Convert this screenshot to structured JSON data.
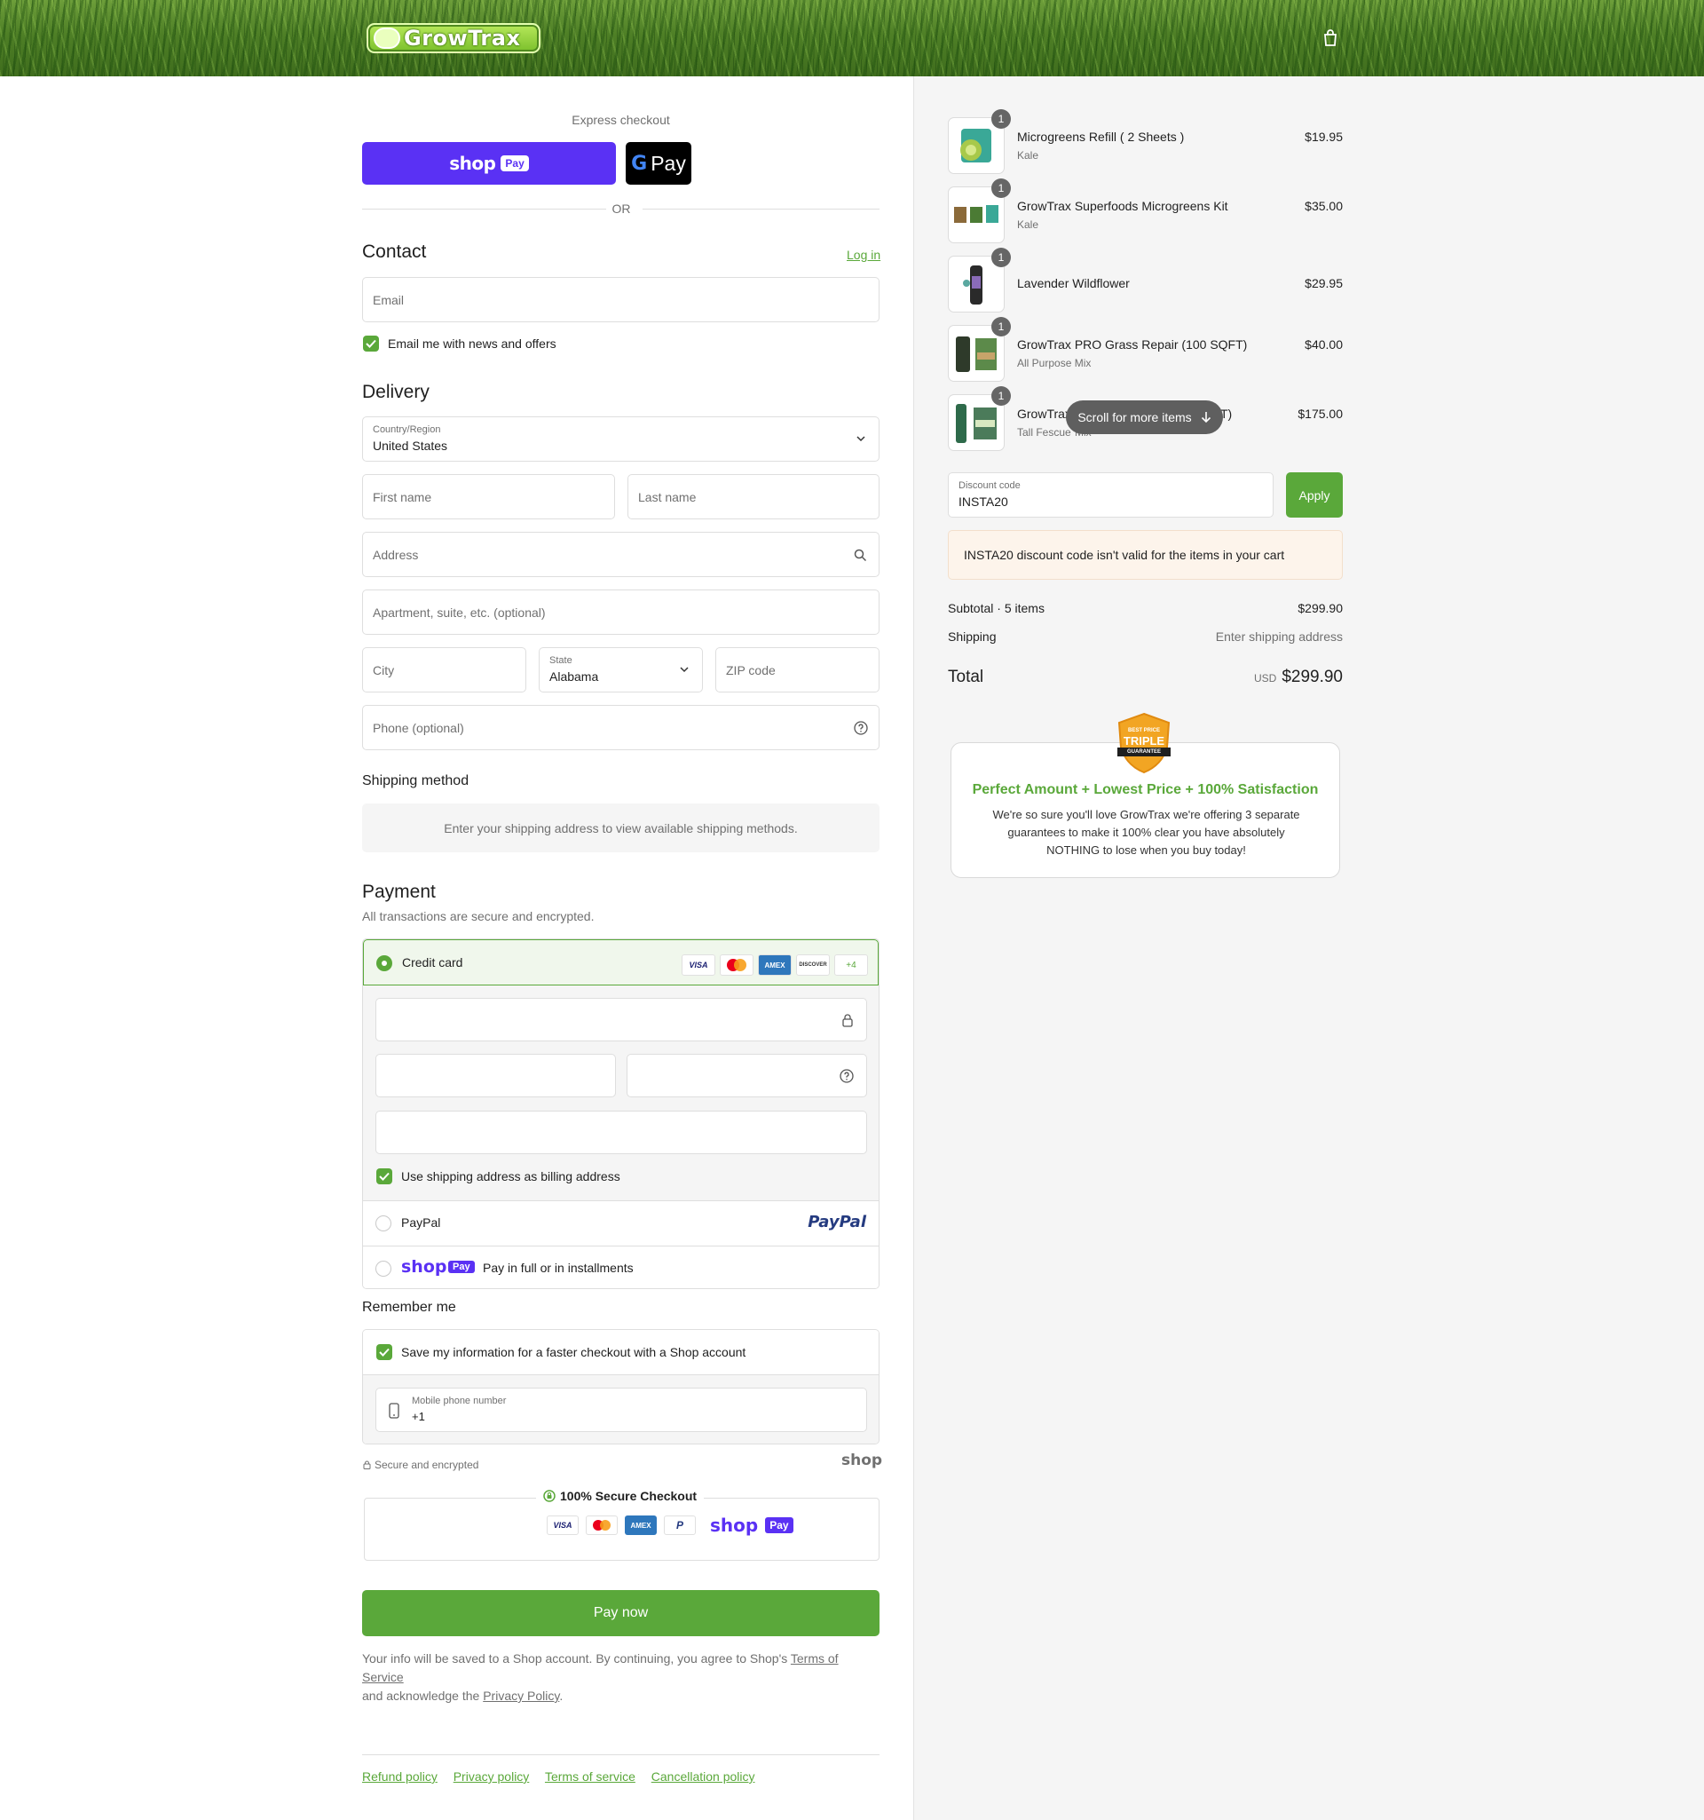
{
  "header": {
    "logo_text": "GrowTrax",
    "cart_icon": "shopping-bag-icon"
  },
  "express": {
    "title": "Express checkout",
    "shop_pay": "shop",
    "shop_pay_badge": "Pay",
    "gpay_label": "Pay",
    "or": "OR"
  },
  "contact": {
    "title": "Contact",
    "login": "Log in",
    "email_placeholder": "Email",
    "news_label": "Email me with news and offers"
  },
  "delivery": {
    "title": "Delivery",
    "country_label": "Country/Region",
    "country_value": "United States",
    "first_name": "First name",
    "last_name": "Last name",
    "address": "Address",
    "apartment": "Apartment, suite, etc. (optional)",
    "city": "City",
    "state_label": "State",
    "state_value": "Alabama",
    "zip": "ZIP code",
    "phone": "Phone (optional)"
  },
  "shipping": {
    "title": "Shipping method",
    "message": "Enter your shipping address to view available shipping methods."
  },
  "payment": {
    "title": "Payment",
    "subtitle": "All transactions are secure and encrypted.",
    "credit_card": "Credit card",
    "cards": [
      "VISA",
      "",
      "AMEX",
      "DISCOVER",
      "+4"
    ],
    "billing_same": "Use shipping address as billing address",
    "paypal": "PayPal",
    "paypal_logo": "PayPal",
    "shop_pay": "shop",
    "shop_pay_badge": "Pay",
    "shop_pay_text": "Pay in full or in installments"
  },
  "remember": {
    "title": "Remember me",
    "save_label": "Save my information for a faster checkout with a Shop account",
    "mobile_label": "Mobile phone number",
    "mobile_value": "+1",
    "secure": "Secure and encrypted",
    "shop_logo": "shop"
  },
  "secure_checkout": {
    "title": "100% Secure Checkout",
    "badges": [
      "VISA",
      "",
      "AMEX",
      "P"
    ],
    "shop": "shop",
    "shop_badge": "Pay"
  },
  "pay_now": "Pay now",
  "legal": {
    "text1": "Your info will be saved to a Shop account. By continuing, you agree to Shop's ",
    "terms": "Terms of Service",
    "text2": "and acknowledge the ",
    "privacy": "Privacy Policy",
    "period": "."
  },
  "footer": {
    "links": [
      "Refund policy",
      "Privacy policy",
      "Terms of service",
      "Cancellation policy"
    ]
  },
  "summary": {
    "items": [
      {
        "name": "Microgreens Refill ( 2 Sheets )",
        "variant": "Kale",
        "price": "$19.95",
        "qty": "1"
      },
      {
        "name": "GrowTrax Superfoods Microgreens Kit",
        "variant": "Kale",
        "price": "$35.00",
        "qty": "1"
      },
      {
        "name": "Lavender Wildflower",
        "variant": "",
        "price": "$29.95",
        "qty": "1"
      },
      {
        "name": "GrowTrax PRO Grass Repair (100 SQFT)",
        "variant": "All Purpose Mix",
        "price": "$40.00",
        "qty": "1"
      },
      {
        "name": "GrowTrax",
        "name_end": "T)",
        "variant": "Tall Fescue",
        "variant_end": "Mix",
        "price": "$175.00",
        "qty": "1"
      }
    ],
    "scroll_hint": "Scroll for more items",
    "discount_label": "Discount code",
    "discount_value": "INSTA20",
    "apply": "Apply",
    "discount_error": "INSTA20 discount code isn't valid for the items in your cart",
    "subtotal_label": "Subtotal · 5 items",
    "subtotal": "$299.90",
    "shipping_label": "Shipping",
    "shipping_value": "Enter shipping address",
    "total_label": "Total",
    "currency": "USD",
    "total": "$299.90"
  },
  "guarantee": {
    "badge_top": "BEST PRICE",
    "badge_main": "TRIPLE",
    "badge_bottom": "GUARANTEE",
    "headline": "Perfect Amount + Lowest Price + 100% Satisfaction",
    "body": "We're so sure you'll love GrowTrax we're offering 3 separate guarantees to make it 100% clear you have absolutely NOTHING to lose when you buy today!"
  },
  "colors": {
    "accent": "#5aa83a",
    "shop_purple": "#5a31f4",
    "error_bg": "#fdf4eb"
  }
}
